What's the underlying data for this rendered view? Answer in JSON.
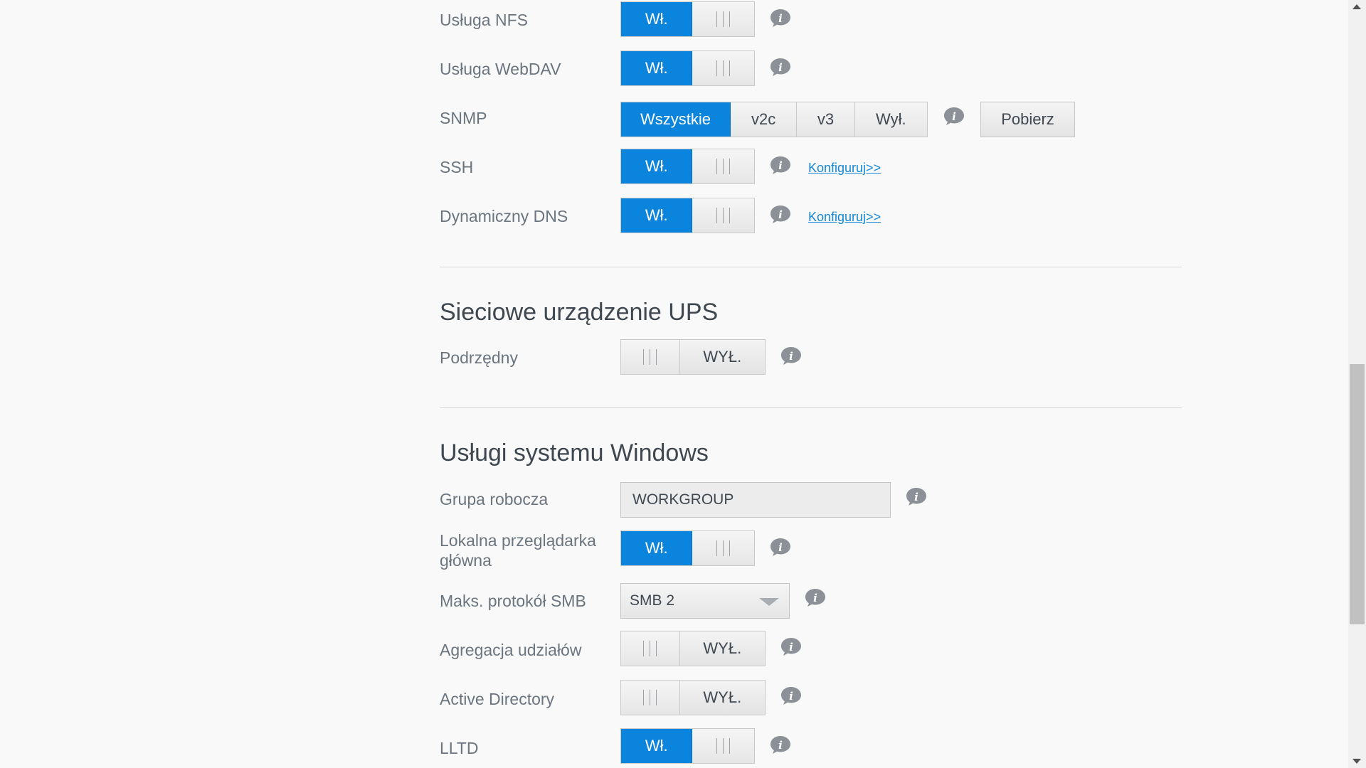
{
  "services": {
    "nfs": {
      "label": "Usługa NFS",
      "state": "Wł."
    },
    "webdav": {
      "label": "Usługa WebDAV",
      "state": "Wł."
    },
    "snmp": {
      "label": "SNMP",
      "options": [
        "Wszystkie",
        "v2c",
        "v3",
        "Wył."
      ],
      "selected": "Wszystkie",
      "download_label": "Pobierz"
    },
    "ssh": {
      "label": "SSH",
      "state": "Wł.",
      "configure_link": "Konfiguruj>>"
    },
    "ddns": {
      "label": "Dynamiczny DNS",
      "state": "Wł.",
      "configure_link": "Konfiguruj>>"
    }
  },
  "ups": {
    "title": "Sieciowe urządzenie UPS",
    "slave": {
      "label": "Podrzędny",
      "state": "WYŁ."
    }
  },
  "windows": {
    "title": "Usługi systemu Windows",
    "workgroup": {
      "label": "Grupa robocza",
      "value": "WORKGROUP"
    },
    "local_master_browser": {
      "label": "Lokalna przeglądarka główna",
      "state": "Wł."
    },
    "max_smb": {
      "label": "Maks. protokół SMB",
      "value": "SMB 2"
    },
    "share_aggregation": {
      "label": "Agregacja udziałów",
      "state": "WYŁ."
    },
    "active_directory": {
      "label": "Active Directory",
      "state": "WYŁ."
    },
    "lltd": {
      "label": "LLTD",
      "state": "Wł."
    }
  },
  "colors": {
    "accent": "#0a84dd",
    "link": "#1487d8",
    "info_icon": "#8b9197"
  },
  "icons": {
    "info": "info-icon"
  }
}
